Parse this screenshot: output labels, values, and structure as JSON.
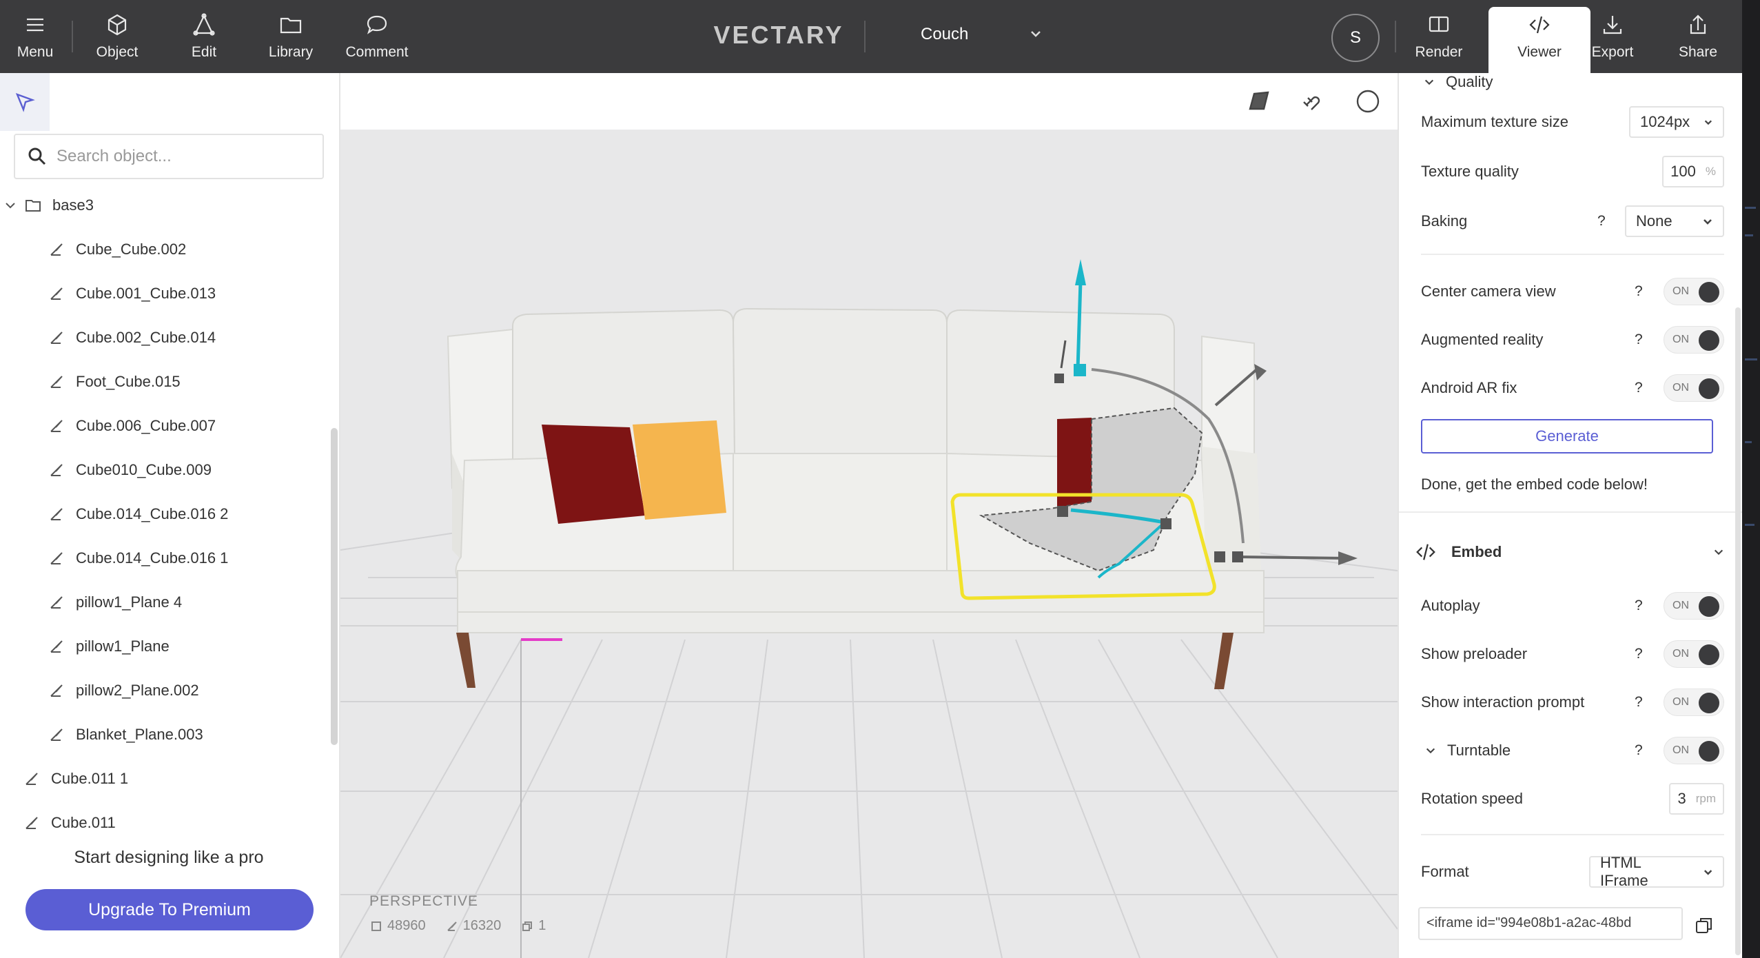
{
  "topbar": {
    "menu_label": "Menu",
    "object_label": "Object",
    "edit_label": "Edit",
    "library_label": "Library",
    "comment_label": "Comment",
    "logo": "VECTARY",
    "doc_name": "Couch",
    "avatar_initial": "S",
    "render_label": "Render",
    "viewer_label": "Viewer",
    "export_label": "Export",
    "share_label": "Share"
  },
  "left_panel": {
    "search_placeholder": "Search object...",
    "tree": {
      "root": "base3",
      "children": [
        "Cube_Cube.002",
        "Cube.001_Cube.013",
        "Cube.002_Cube.014",
        "Foot_Cube.015",
        "Cube.006_Cube.007",
        "Cube010_Cube.009",
        "Cube.014_Cube.016 2",
        "Cube.014_Cube.016 1",
        "pillow1_Plane 4",
        "pillow1_Plane",
        "pillow2_Plane.002",
        "Blanket_Plane.003"
      ],
      "top_level": [
        "Cube.011 1",
        "Cube.011"
      ]
    },
    "promo_text": "Start designing like a pro",
    "upgrade_label": "Upgrade To Premium"
  },
  "viewport": {
    "camera": "PERSPECTIVE",
    "vertices": "48960",
    "faces": "16320",
    "objects": "1",
    "colors": {
      "background": "#e8e8e9",
      "selection": "#f2e22a",
      "gizmo_y": "#1bb6c9",
      "axis_x": "#e43cc8"
    }
  },
  "right_panel": {
    "quality_header": "Quality",
    "max_texture_label": "Maximum texture size",
    "max_texture_value": "1024px",
    "texture_quality_label": "Texture quality",
    "texture_quality_value": "100",
    "texture_quality_unit": "%",
    "baking_label": "Baking",
    "baking_value": "None",
    "help": "?",
    "toggle_on": "ON",
    "center_camera_label": "Center camera view",
    "ar_label": "Augmented reality",
    "android_fix_label": "Android AR fix",
    "generate_label": "Generate",
    "done_text": "Done, get the embed code below!",
    "embed_header": "Embed",
    "autoplay_label": "Autoplay",
    "preloader_label": "Show preloader",
    "interaction_label": "Show interaction prompt",
    "turntable_label": "Turntable",
    "rotation_label": "Rotation speed",
    "rotation_value": "3",
    "rotation_unit": "rpm",
    "format_label": "Format",
    "format_value": "HTML IFrame",
    "embed_code": "<iframe id=\"994e08b1-a2ac-48bd",
    "accent_color": "#5a5ed4"
  }
}
